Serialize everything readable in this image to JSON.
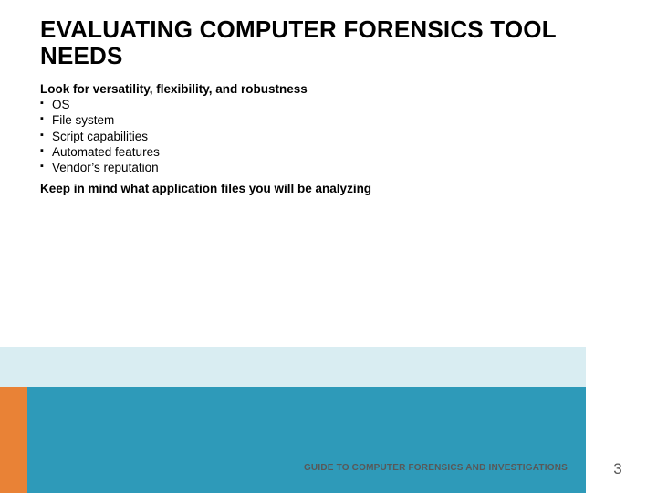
{
  "title": "EVALUATING COMPUTER FORENSICS TOOL NEEDS",
  "subhead": "Look for versatility, flexibility, and robustness",
  "bullets": [
    "OS",
    "File system",
    "Script capabilities",
    "Automated features",
    "Vendor’s reputation"
  ],
  "note": "Keep in mind what application files you will be analyzing",
  "footer": "GUIDE TO COMPUTER FORENSICS AND INVESTIGATIONS",
  "page": "3"
}
